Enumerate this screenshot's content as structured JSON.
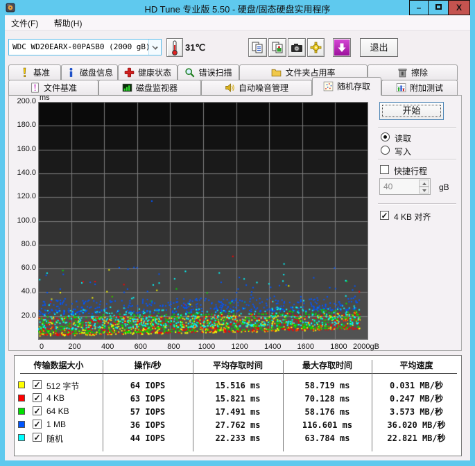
{
  "window": {
    "title": "HD Tune 专业版 5.50 - 硬盘/固态硬盘实用程序",
    "controls": {
      "minimize": "–",
      "maximize": "",
      "close": "X"
    }
  },
  "menu": {
    "items": [
      {
        "label": "文件(F)"
      },
      {
        "label": "帮助(H)"
      }
    ]
  },
  "toolbar": {
    "drive_select": {
      "value": "WDC WD20EARX-00PASB0 (2000 gB)"
    },
    "temperature": "31℃",
    "icons": [
      "thermometer-icon",
      "copy-text-icon",
      "copy-image-icon",
      "camera-icon",
      "options-icon",
      "save-icon"
    ],
    "exit_label": "退出"
  },
  "tabs": {
    "row1": [
      {
        "label": "基准",
        "icon": "benchmark-icon"
      },
      {
        "label": "磁盘信息",
        "icon": "disk-info-icon"
      },
      {
        "label": "健康状态",
        "icon": "health-status-icon"
      },
      {
        "label": "错误扫描",
        "icon": "error-scan-icon"
      },
      {
        "label": "文件夹占用率",
        "icon": "folder-usage-icon"
      },
      {
        "label": "擦除",
        "icon": "erase-icon"
      }
    ],
    "row2": [
      {
        "label": "文件基准",
        "icon": "file-benchmark-icon"
      },
      {
        "label": "磁盘监视器",
        "icon": "disk-monitor-icon"
      },
      {
        "label": "自动噪音管理",
        "icon": "aam-icon"
      },
      {
        "label": "随机存取",
        "icon": "random-access-icon",
        "active": true
      },
      {
        "label": "附加测试",
        "icon": "extra-tests-icon"
      }
    ],
    "active_tab": "随机存取"
  },
  "panel": {
    "start_label": "开始",
    "read_label": "读取",
    "write_label": "写入",
    "read_selected": true,
    "write_selected": false,
    "short_stroke": {
      "label": "快捷行程",
      "checked": false,
      "value": "40",
      "unit": "gB"
    },
    "align_4kb": {
      "label": "4 KB 对齐",
      "checked": true
    }
  },
  "chart_data": {
    "type": "scatter",
    "title": "随机存取 access time vs disk position",
    "x_unit": "gB",
    "y_unit": "ms",
    "xlim": [
      0,
      2000
    ],
    "ylim": [
      0,
      200
    ],
    "x_ticks": [
      0,
      200,
      400,
      600,
      800,
      1000,
      1200,
      1400,
      1600,
      1800,
      2000
    ],
    "y_ticks": [
      20,
      40,
      60,
      80,
      100,
      120,
      140,
      160,
      180,
      200
    ],
    "grid": true,
    "grid_color": "#7E7E7E",
    "background_top": "#0A0A0A",
    "background_bottom": "#525252",
    "x_max_data": 1950,
    "series": [
      {
        "name": "512 字节",
        "color": "#FFFF00",
        "count": 550,
        "min_start": 3.0,
        "min_end": 8.5,
        "spread": 15,
        "tail_rate": 0.01,
        "tail_max": 48,
        "max_point": {
          "x": 430,
          "y": 58.719
        }
      },
      {
        "name": "4 KB",
        "color": "#FF0000",
        "count": 550,
        "min_start": 3.5,
        "min_end": 9.0,
        "spread": 15,
        "tail_rate": 0.01,
        "tail_max": 52,
        "max_point": {
          "x": 1180,
          "y": 70.128
        }
      },
      {
        "name": "64 KB",
        "color": "#00E000",
        "count": 550,
        "min_start": 4.5,
        "min_end": 10.0,
        "spread": 16,
        "tail_rate": 0.018,
        "tail_max": 55,
        "max_point": {
          "x": 150,
          "y": 58.176
        }
      },
      {
        "name": "随机",
        "color": "#00FFFF",
        "count": 480,
        "min_start": 8.5,
        "min_end": 13.0,
        "spread": 16,
        "tail_rate": 0.045,
        "tail_max": 58,
        "max_point": {
          "x": 1490,
          "y": 63.784
        }
      },
      {
        "name": "1 MB",
        "color": "#0055FF",
        "count": 430,
        "min_start": 21.0,
        "min_end": 25.0,
        "spread": 12,
        "tail_rate": 0.06,
        "tail_max": 62,
        "max_point": {
          "x": 689,
          "y": 116.601
        }
      }
    ]
  },
  "table": {
    "headers": [
      "传输数据大小",
      "操作/秒",
      "平均存取时间",
      "最大存取时间",
      "平均速度"
    ],
    "rows": [
      {
        "color": "#FFFF00",
        "checked": true,
        "label": "512 字节",
        "iops": "64 IOPS",
        "avg_time": "15.516 ms",
        "max_time": "58.719 ms",
        "avg_speed": "0.031 MB/秒"
      },
      {
        "color": "#FF0000",
        "checked": true,
        "label": "4 KB",
        "iops": "63 IOPS",
        "avg_time": "15.821 ms",
        "max_time": "70.128 ms",
        "avg_speed": "0.247 MB/秒"
      },
      {
        "color": "#00E000",
        "checked": true,
        "label": "64 KB",
        "iops": "57 IOPS",
        "avg_time": "17.491 ms",
        "max_time": "58.176 ms",
        "avg_speed": "3.573 MB/秒"
      },
      {
        "color": "#0055FF",
        "checked": true,
        "label": "1 MB",
        "iops": "36 IOPS",
        "avg_time": "27.762 ms",
        "max_time": "116.601 ms",
        "avg_speed": "36.020 MB/秒"
      },
      {
        "color": "#00FFFF",
        "checked": true,
        "label": "随机",
        "iops": "44 IOPS",
        "avg_time": "22.233 ms",
        "max_time": "63.784 ms",
        "avg_speed": "22.821 MB/秒"
      }
    ]
  },
  "colors": {
    "titlebar": "#5FC9EE",
    "close_button": "#C4534F",
    "window_bg": "#F3EFF2",
    "save_button": "#B81CB8"
  }
}
